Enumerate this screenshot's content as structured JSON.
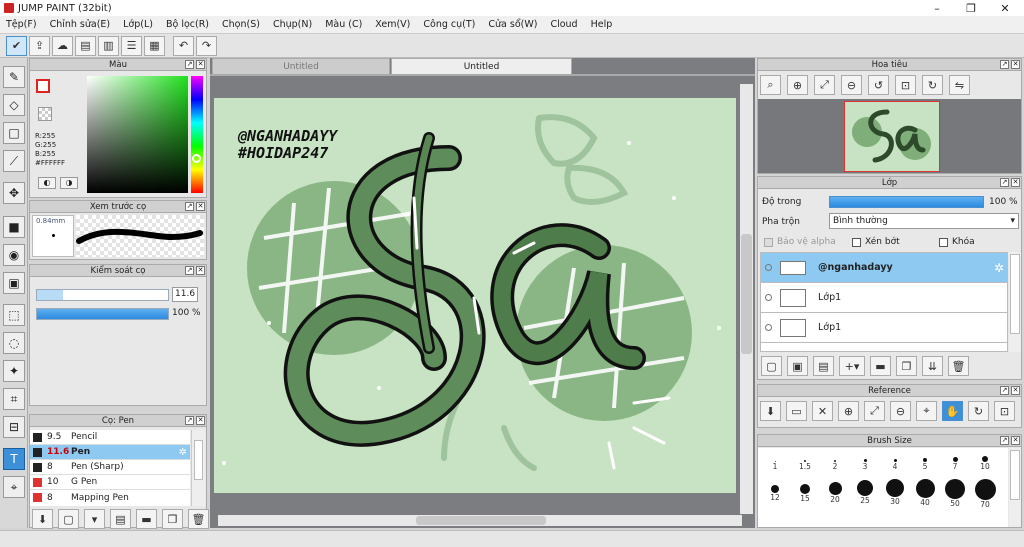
{
  "window": {
    "title": "JUMP PAINT (32bit)",
    "minimize": "–",
    "maximize": "❐",
    "close": "✕"
  },
  "menu": [
    "Tệp(F)",
    "Chỉnh sửa(E)",
    "Lớp(L)",
    "Bộ lọc(R)",
    "Chọn(S)",
    "Chụp(N)",
    "Màu (C)",
    "Xem(V)",
    "Công cụ(T)",
    "Cửa sổ(W)",
    "Cloud",
    "Help"
  ],
  "tabs": [
    "Untitled",
    "Untitled"
  ],
  "color_panel": {
    "title": "Màu",
    "r": "R:255",
    "g": "G:255",
    "b": "B:255",
    "hex": "#FFFFFF"
  },
  "preview_panel": {
    "title": "Xem trước cọ",
    "size": "0.84mm"
  },
  "brush_control": {
    "title": "Kiểm soát cọ",
    "size_value": "11.6",
    "opacity_value": "100 %",
    "size_level": 0.2,
    "opacity_level": 1.0
  },
  "brush_panel": {
    "title": "Cọ: Pen",
    "items": [
      {
        "size": "9.5",
        "name": "Pencil",
        "swatch": "#222222"
      },
      {
        "size": "11.6",
        "name": "Pen",
        "swatch": "#222222"
      },
      {
        "size": "8",
        "name": "Pen (Sharp)",
        "swatch": "#222222"
      },
      {
        "size": "10",
        "name": "G Pen",
        "swatch": "#dd3333"
      },
      {
        "size": "8",
        "name": "Mapping Pen",
        "swatch": "#dd3333"
      }
    ]
  },
  "artwork": {
    "line1": "@NGANHADAYY",
    "line2": "#HOIDAP247",
    "letters": "Sa"
  },
  "navigator": {
    "title": "Hoa tiêu"
  },
  "layer_panel": {
    "title": "Lớp",
    "opacity_label": "Độ trong",
    "opacity_value": "100 %",
    "blend_label": "Pha trộn",
    "blend_value": "Bình thường",
    "protect_alpha": "Bảo vệ alpha",
    "clip": "Xén bớt",
    "lock": "Khóa",
    "layers": [
      {
        "name": "@nganhadayy",
        "selected": true
      },
      {
        "name": "Lớp1",
        "selected": false
      },
      {
        "name": "Lớp1",
        "selected": false
      }
    ]
  },
  "reference_panel": {
    "title": "Reference"
  },
  "brush_size": {
    "title": "Brush Size",
    "row1": [
      "1",
      "1.5",
      "2",
      "3",
      "4",
      "5",
      "7",
      "10"
    ],
    "row2": [
      "12",
      "15",
      "20",
      "25",
      "30",
      "40",
      "50",
      "70"
    ]
  },
  "colors": {
    "accent": "#3d8fd8",
    "canvas": "#c7e3c3",
    "selected_row": "#8ec9f2"
  }
}
